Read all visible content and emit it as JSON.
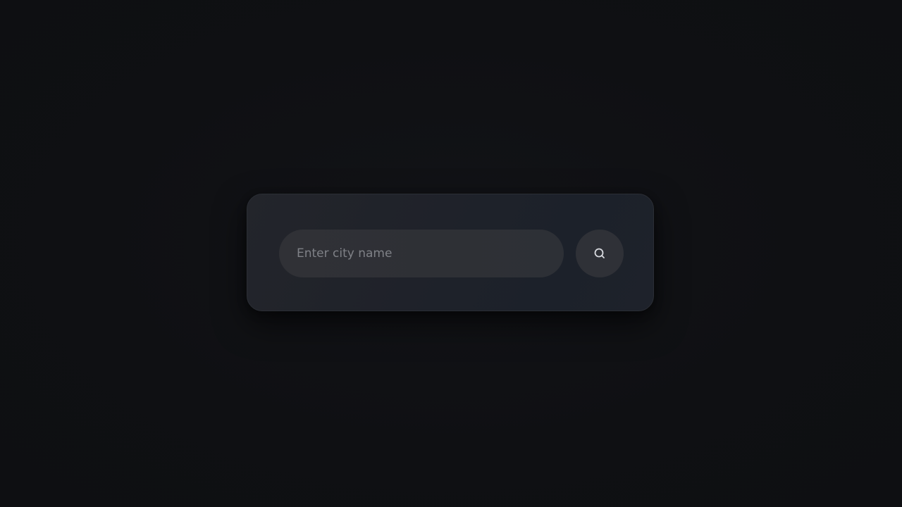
{
  "search": {
    "placeholder": "Enter city name",
    "value": "",
    "button_icon": "search-icon"
  },
  "colors": {
    "background": "#0f1013",
    "card": "#1f222a",
    "input": "#2f3136",
    "button": "#2f3137",
    "icon": "#d9dbe0",
    "placeholder": "#7f8187"
  }
}
